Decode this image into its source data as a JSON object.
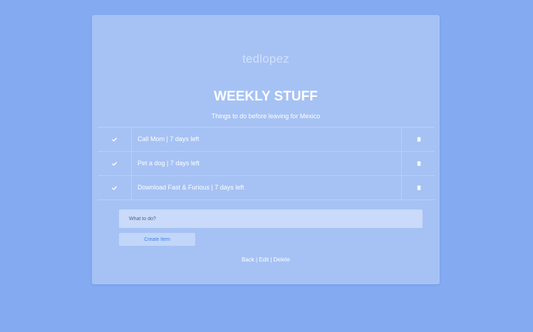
{
  "header": {
    "username": "tedlopez"
  },
  "list": {
    "title": "WEEKLY STUFF",
    "subtitle": "Things to do before leaving for Mexico"
  },
  "items": [
    {
      "text": "Call Mom | 7 days left"
    },
    {
      "text": "Pet a dog | 7 days left"
    },
    {
      "text": "Download Fast & Furious | 7 days left"
    }
  ],
  "form": {
    "placeholder": "What to do?",
    "submit_label": "Create Item"
  },
  "footer": {
    "back_label": "Back",
    "separator": "|",
    "edit_label": "Edit",
    "delete_label": "Delete"
  },
  "icons": {
    "complete": "check-icon",
    "delete": "trash-icon"
  },
  "colors": {
    "background": "#84abf2",
    "card": "#a6c2f4",
    "accent": "#3e82ec"
  }
}
